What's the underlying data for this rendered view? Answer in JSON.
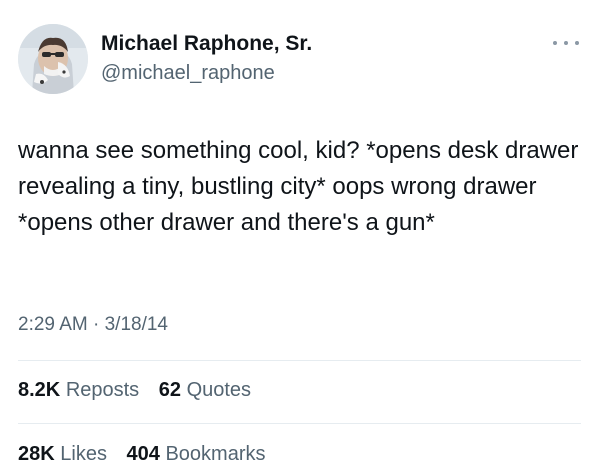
{
  "author": {
    "name": "Michael Raphone, Sr.",
    "handle": "@michael_raphone",
    "avatar_icon": "profile-photo"
  },
  "tweet": {
    "text": "wanna see something cool, kid? *opens desk drawer revealing a tiny, bustling city* oops wrong drawer *opens other drawer and there's a gun*",
    "time": "2:29 AM",
    "separator": "·",
    "date": "3/18/14"
  },
  "stats_row_1": {
    "reposts_count": "8.2K",
    "reposts_label": "Reposts",
    "quotes_count": "62",
    "quotes_label": "Quotes"
  },
  "stats_row_2": {
    "likes_count": "28K",
    "likes_label": "Likes",
    "bookmarks_count": "404",
    "bookmarks_label": "Bookmarks"
  },
  "colors": {
    "text_primary": "#0f1419",
    "text_secondary": "#536471",
    "divider": "#e6ecf0"
  }
}
